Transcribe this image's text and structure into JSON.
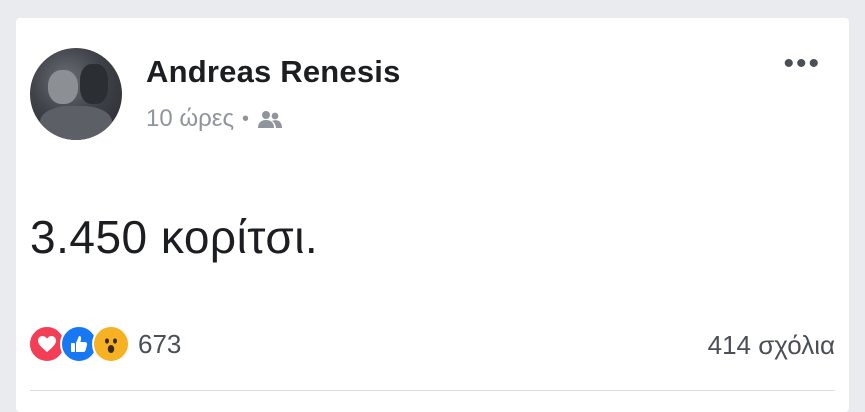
{
  "post": {
    "author": "Andreas Renesis",
    "time": "10 ώρες",
    "separator": "•",
    "audience_icon": "friends-icon",
    "text": "3.450  κορίτσι.",
    "more_label": "•••"
  },
  "reactions": {
    "types": [
      "love",
      "like",
      "wow"
    ],
    "count": "673"
  },
  "comments": {
    "label": "414 σχόλια"
  },
  "colors": {
    "love": "#f33e58",
    "like": "#1877f2",
    "wow": "#f7b125",
    "name": "#1c1e21",
    "meta": "#90949c"
  }
}
